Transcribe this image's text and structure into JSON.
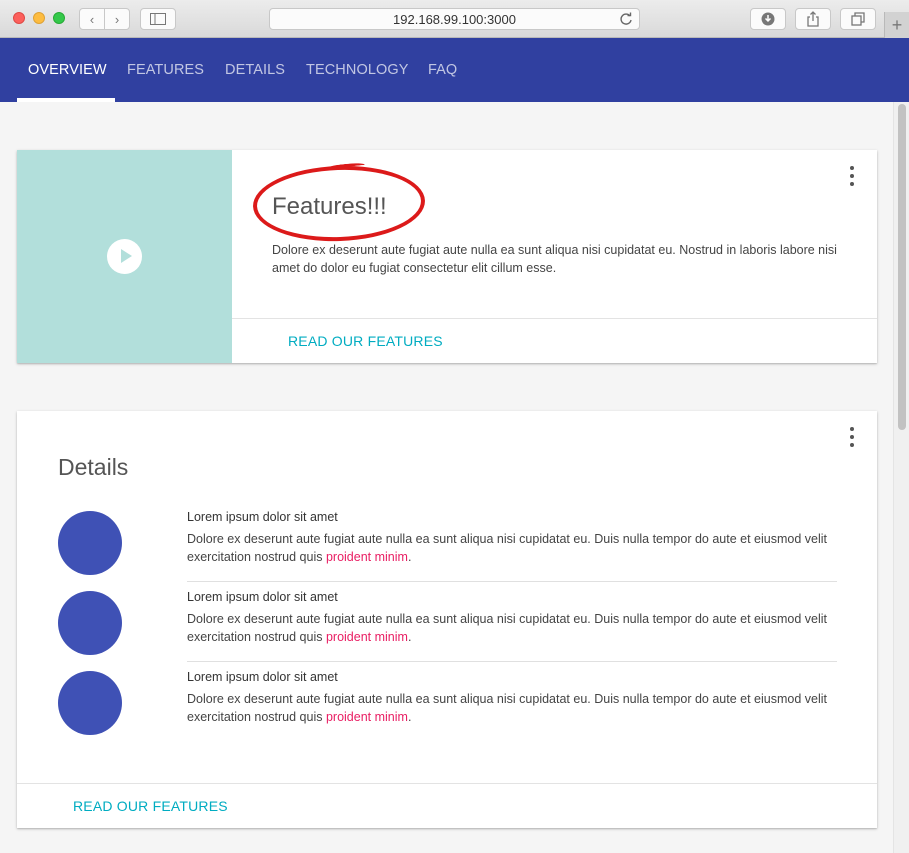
{
  "browser": {
    "address": "192.168.99.100:3000",
    "back_icon": "‹",
    "forward_icon": "›",
    "new_tab_icon": "+"
  },
  "appbar": {
    "color": "#3040a0",
    "tabs": [
      {
        "label": "OVERVIEW",
        "active": true
      },
      {
        "label": "FEATURES",
        "active": false
      },
      {
        "label": "DETAILS",
        "active": false
      },
      {
        "label": "TECHNOLOGY",
        "active": false
      },
      {
        "label": "FAQ",
        "active": false
      }
    ]
  },
  "features_card": {
    "title": "Features!!!",
    "text": "Dolore ex deserunt aute fugiat aute nulla ea sunt aliqua nisi cupidatat eu. Nostrud in laboris labore nisi amet do dolor eu fugiat consectetur elit cillum esse.",
    "action": "READ OUR FEATURES",
    "media_color": "#b2dfdb",
    "annotation_color": "#dc1a1a"
  },
  "details_card": {
    "title": "Details",
    "items": [
      {
        "heading": "Lorem ipsum dolor sit amet",
        "body": "Dolore ex deserunt aute fugiat aute nulla ea sunt aliqua nisi cupidatat eu. Duis nulla tempor do aute et eiusmod velit exercitation nostrud quis ",
        "link": "proident minim",
        "end": "."
      },
      {
        "heading": "Lorem ipsum dolor sit amet",
        "body": "Dolore ex deserunt aute fugiat aute nulla ea sunt aliqua nisi cupidatat eu. Duis nulla tempor do aute et eiusmod velit exercitation nostrud quis ",
        "link": "proident minim",
        "end": "."
      },
      {
        "heading": "Lorem ipsum dolor sit amet",
        "body": "Dolore ex deserunt aute fugiat aute nulla ea sunt aliqua nisi cupidatat eu. Duis nulla tempor do aute et eiusmod velit exercitation nostrud quis ",
        "link": "proident minim",
        "end": "."
      }
    ],
    "action": "READ OUR FEATURES",
    "avatar_color": "#3f51b5",
    "link_color": "#e91e63"
  }
}
